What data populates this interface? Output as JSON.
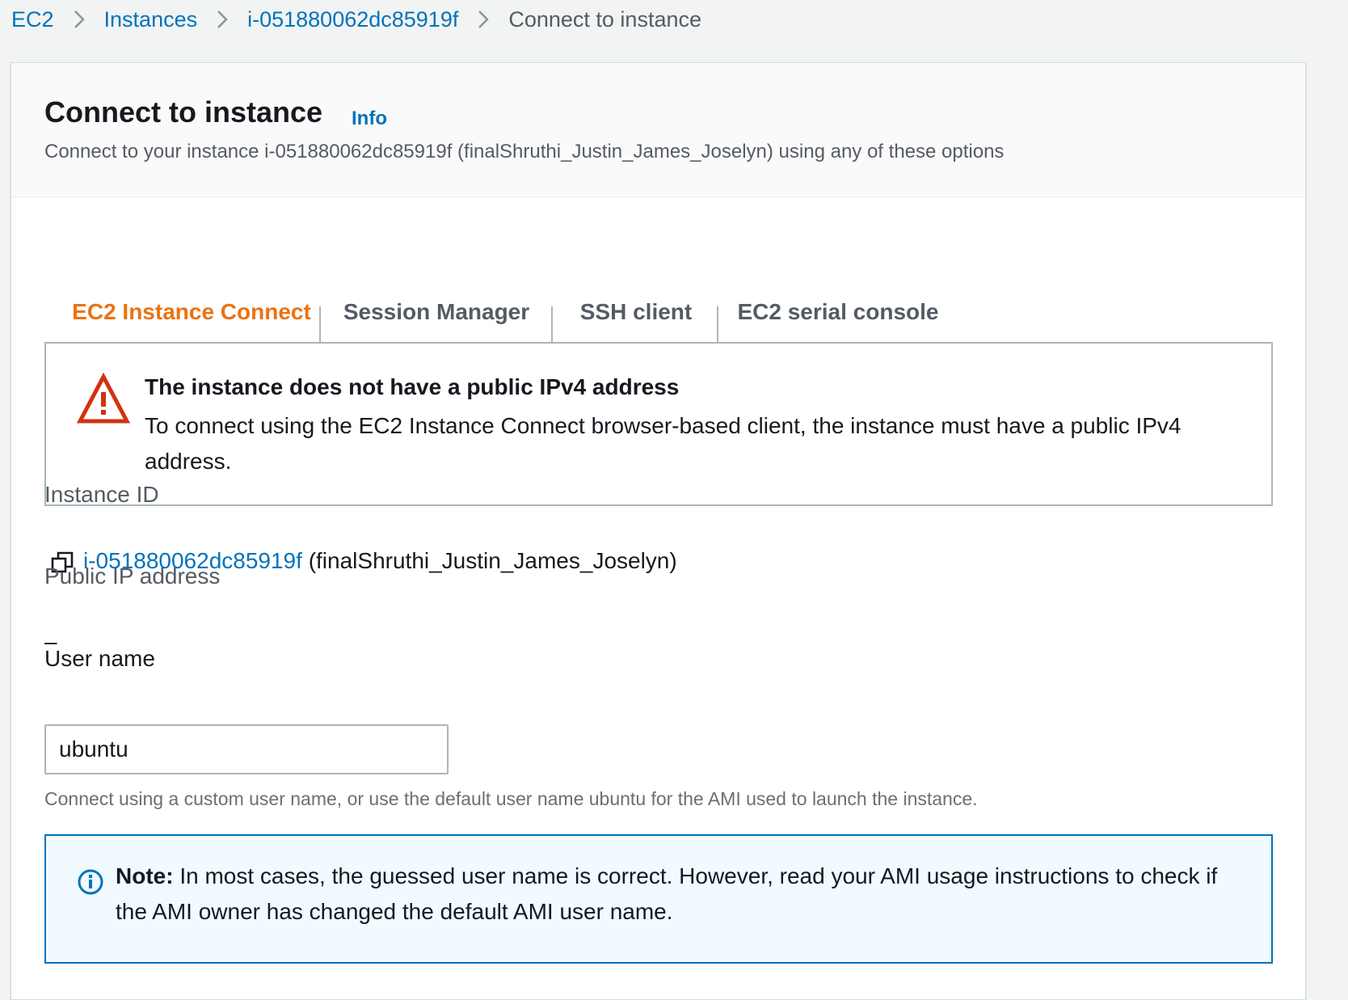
{
  "breadcrumb": {
    "items": [
      "EC2",
      "Instances",
      "i-051880062dc85919f"
    ],
    "current": "Connect to instance"
  },
  "header": {
    "title": "Connect to instance",
    "info_label": "Info",
    "subtitle": "Connect to your instance i-051880062dc85919f (finalShruthi_Justin_James_Joselyn) using any of these options"
  },
  "tabs": [
    {
      "label": "EC2 Instance Connect",
      "active": true
    },
    {
      "label": "Session Manager",
      "active": false
    },
    {
      "label": "SSH client",
      "active": false
    },
    {
      "label": "EC2 serial console",
      "active": false
    }
  ],
  "error_alert": {
    "icon": "warning-triangle-icon",
    "title": "The instance does not have a public IPv4 address",
    "body": "To connect using the EC2 Instance Connect browser-based client, the instance must have a public IPv4 address."
  },
  "instance": {
    "label": "Instance ID",
    "id": "i-051880062dc85919f",
    "name": "(finalShruthi_Justin_James_Joselyn)"
  },
  "public_ip": {
    "label": "Public IP address",
    "value": "–"
  },
  "user_name": {
    "label": "User name",
    "value": "ubuntu",
    "hint": "Connect using a custom user name, or use the default user name ubuntu for the AMI used to launch the instance."
  },
  "note_alert": {
    "icon": "info-circle-icon",
    "bold": "Note:",
    "text": " In most cases, the guessed user name is correct. However, read your AMI usage instructions to check if the AMI owner has changed the default AMI user name."
  },
  "colors": {
    "link": "#0073bb",
    "active_tab": "#ec7211",
    "error": "#d13212",
    "info_border": "#0073bb",
    "info_bg": "#f1faff"
  }
}
